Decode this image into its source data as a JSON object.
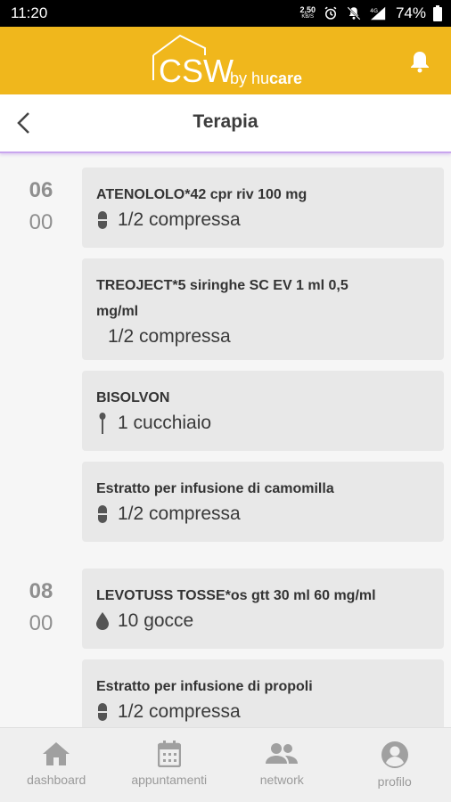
{
  "status": {
    "time": "11:20",
    "speed_value": "2,50",
    "speed_unit": "KB/S",
    "network": "4G",
    "battery": "74%"
  },
  "brand": {
    "logo_main": "CSW",
    "logo_by": "by",
    "logo_hu": "hu",
    "logo_care": "care"
  },
  "header": {
    "title": "Terapia"
  },
  "schedule": [
    {
      "hour": "06",
      "minute": "00",
      "items": [
        {
          "name": "ATENOLOLO*42 cpr riv 100 mg",
          "name_line2": "",
          "dose": "1/2 compressa",
          "icon": "pill-icon"
        },
        {
          "name": "TREOJECT*5 siringhe SC EV 1 ml 0,5",
          "name_line2": "mg/ml",
          "dose": "1/2 compressa",
          "icon": ""
        },
        {
          "name": "BISOLVON",
          "name_line2": "",
          "dose": "1 cucchiaio",
          "icon": "spoon-icon"
        },
        {
          "name": "Estratto per infusione di camomilla",
          "name_line2": "",
          "dose": "1/2 compressa",
          "icon": "pill-icon"
        }
      ]
    },
    {
      "hour": "08",
      "minute": "00",
      "items": [
        {
          "name": "LEVOTUSS TOSSE*os gtt 30 ml 60 mg/ml",
          "name_line2": "",
          "dose": "10 gocce",
          "icon": "drop-icon"
        },
        {
          "name": "Estratto per infusione di propoli",
          "name_line2": "",
          "dose": "1/2 compressa",
          "icon": "pill-icon"
        }
      ]
    }
  ],
  "nav": [
    {
      "label": "dashboard",
      "icon": "home-icon"
    },
    {
      "label": "appuntamenti",
      "icon": "calendar-icon"
    },
    {
      "label": "network",
      "icon": "people-icon"
    },
    {
      "label": "profilo",
      "icon": "account-icon"
    }
  ],
  "colors": {
    "brand": "#f0b71c",
    "accent_line": "#c9a6ee",
    "card": "#e8e8e8",
    "muted": "#9c9c9c"
  }
}
